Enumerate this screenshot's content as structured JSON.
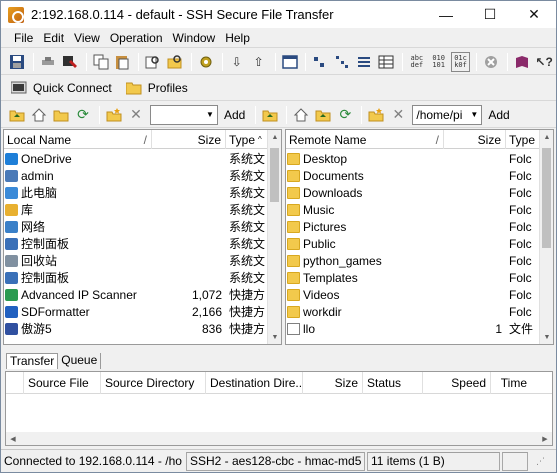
{
  "window": {
    "title": "2:192.168.0.114 - default - SSH Secure File Transfer",
    "minimize": "—",
    "maximize": "☐",
    "close": "✕"
  },
  "menu": [
    "File",
    "Edit",
    "View",
    "Operation",
    "Window",
    "Help"
  ],
  "toolbar2": {
    "quick_connect": "Quick Connect",
    "profiles": "Profiles"
  },
  "toolbar3": {
    "local_path": "",
    "add_left": "Add",
    "remote_path": "/home/pi",
    "add_right": "Add"
  },
  "local_pane": {
    "columns": [
      "Local Name",
      "/",
      "Size",
      "Type"
    ],
    "rows": [
      {
        "name": "OneDrive",
        "size": "",
        "type": "系统文",
        "icon": "onedrive-icon",
        "color": "#1e7fd8"
      },
      {
        "name": "admin",
        "size": "",
        "type": "系统文",
        "icon": "user-icon",
        "color": "#4a7ab8"
      },
      {
        "name": "此电脑",
        "size": "",
        "type": "系统文",
        "icon": "computer-icon",
        "color": "#3a8ad8"
      },
      {
        "name": "库",
        "size": "",
        "type": "系统文",
        "icon": "library-icon",
        "color": "#e8b030"
      },
      {
        "name": "网络",
        "size": "",
        "type": "系统文",
        "icon": "network-icon",
        "color": "#3a80c8"
      },
      {
        "name": "控制面板",
        "size": "",
        "type": "系统文",
        "icon": "control-panel-icon",
        "color": "#3a70b8"
      },
      {
        "name": "回收站",
        "size": "",
        "type": "系统文",
        "icon": "recycle-bin-icon",
        "color": "#8090a0"
      },
      {
        "name": "控制面板",
        "size": "",
        "type": "系统文",
        "icon": "control-panel-icon",
        "color": "#3a70b8"
      },
      {
        "name": "Advanced IP Scanner",
        "size": "1,072",
        "type": "快捷方",
        "icon": "shortcut-icon",
        "color": "#2a9a50"
      },
      {
        "name": "SDFormatter",
        "size": "2,166",
        "type": "快捷方",
        "icon": "shortcut-icon",
        "color": "#2060c0"
      },
      {
        "name": "傲游5",
        "size": "836",
        "type": "快捷方",
        "icon": "shortcut-icon",
        "color": "#3050a0"
      }
    ]
  },
  "remote_pane": {
    "columns": [
      "Remote Name",
      "/",
      "Size",
      "Type"
    ],
    "rows": [
      {
        "name": "Desktop",
        "size": "",
        "type": "Folc"
      },
      {
        "name": "Documents",
        "size": "",
        "type": "Folc"
      },
      {
        "name": "Downloads",
        "size": "",
        "type": "Folc"
      },
      {
        "name": "Music",
        "size": "",
        "type": "Folc"
      },
      {
        "name": "Pictures",
        "size": "",
        "type": "Folc"
      },
      {
        "name": "Public",
        "size": "",
        "type": "Folc"
      },
      {
        "name": "python_games",
        "size": "",
        "type": "Folc"
      },
      {
        "name": "Templates",
        "size": "",
        "type": "Folc"
      },
      {
        "name": "Videos",
        "size": "",
        "type": "Folc"
      },
      {
        "name": "workdir",
        "size": "",
        "type": "Folc"
      },
      {
        "name": "llo",
        "size": "1",
        "type": "文件"
      }
    ]
  },
  "tabs": [
    "Transfer",
    "Queue"
  ],
  "transfer_columns": [
    "Source File",
    "Source Directory",
    "Destination Dire...",
    "Size",
    "Status",
    "Speed",
    "Time"
  ],
  "status": {
    "connection": "Connected to 192.168.0.114 - /ho",
    "cipher": "SSH2 - aes128-cbc - hmac-md5",
    "items": "11 items (1 B)"
  }
}
